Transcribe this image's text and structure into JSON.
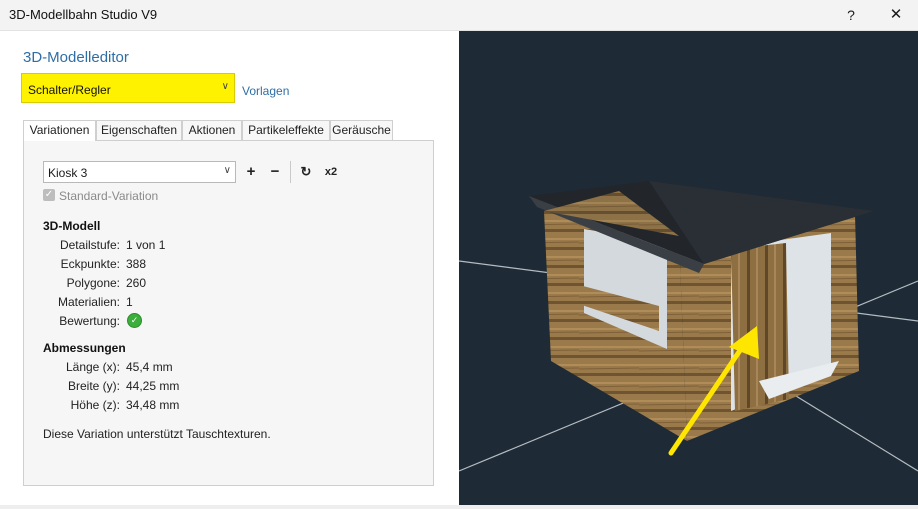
{
  "window": {
    "title": "3D-Modellbahn Studio V9",
    "help_label": "?",
    "close_label": "✕"
  },
  "editor": {
    "heading": "3D-Modelleditor",
    "category": {
      "value": "Schalter/Regler",
      "highlight": "#fff200"
    },
    "templates_link": "Vorlagen"
  },
  "tabs": [
    {
      "label": "Variationen",
      "active": true
    },
    {
      "label": "Eigenschaften",
      "active": false
    },
    {
      "label": "Aktionen",
      "active": false
    },
    {
      "label": "Partikeleffekte",
      "active": false
    },
    {
      "label": "Geräusche",
      "active": false
    }
  ],
  "variation": {
    "selected": "Kiosk 3",
    "add_label": "+",
    "remove_label": "−",
    "refresh_icon": "refresh-icon",
    "duplicate_label": "x2",
    "standard_label": "Standard-Variation",
    "standard_checked": true
  },
  "model": {
    "title": "3D-Modell",
    "props": [
      {
        "label": "Detailstufe:",
        "value": "1 von 1"
      },
      {
        "label": "Eckpunkte:",
        "value": "388"
      },
      {
        "label": "Polygone:",
        "value": "260"
      },
      {
        "label": "Materialien:",
        "value": "1"
      }
    ],
    "rating_label": "Bewertung:",
    "rating_icon": "check-circle-icon",
    "rating_color": "#3cae3c"
  },
  "dimensions": {
    "title": "Abmessungen",
    "props": [
      {
        "label": "Länge (x):",
        "value": "45,4 mm"
      },
      {
        "label": "Breite (y):",
        "value": "44,25 mm"
      },
      {
        "label": "Höhe (z):",
        "value": "34,48 mm"
      }
    ]
  },
  "note": "Diese Variation unterstützt Tauschtexturen.",
  "viewport": {
    "background": "#1e2a35",
    "arrow_color": "#ffe600"
  }
}
